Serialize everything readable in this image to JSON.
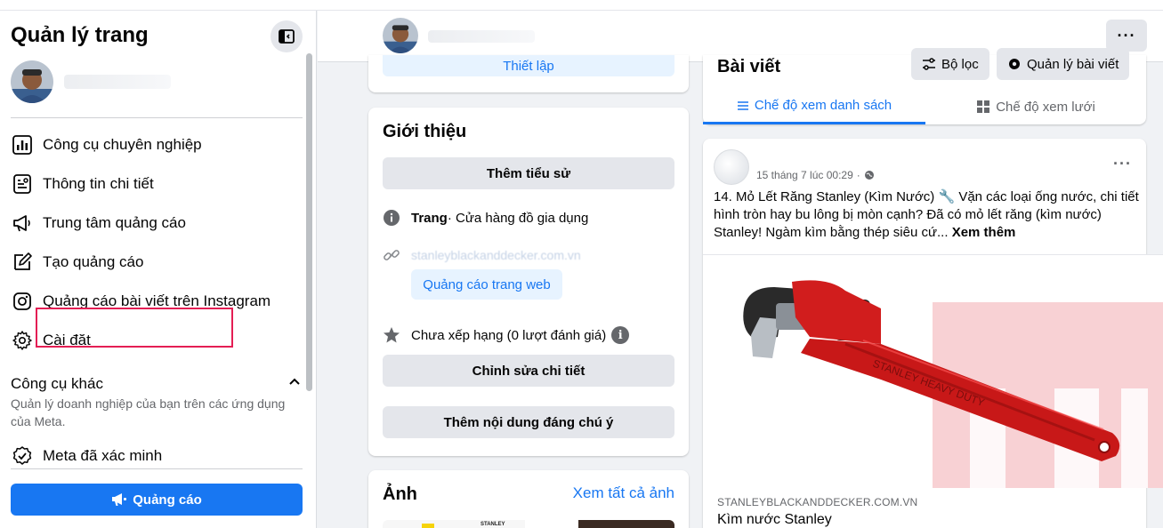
{
  "sidebar": {
    "title": "Quản lý trang",
    "items": [
      {
        "label": "Công cụ chuyên nghiệp",
        "icon": "bar-chart-icon"
      },
      {
        "label": "Thông tin chi tiết",
        "icon": "insights-icon"
      },
      {
        "label": "Trung tâm quảng cáo",
        "icon": "megaphone-icon"
      },
      {
        "label": "Tạo quảng cáo",
        "icon": "pencil-icon"
      },
      {
        "label": "Quảng cáo bài viết trên Instagram",
        "icon": "instagram-icon"
      },
      {
        "label": "Cài đặt",
        "icon": "gear-icon"
      }
    ],
    "other_tools": {
      "title": "Công cụ khác",
      "description": "Quản lý doanh nghiệp của bạn trên các ứng dụng của Meta."
    },
    "verified": {
      "label": "Meta đã xác minh",
      "icon": "verified-badge-icon"
    },
    "cta_label": "Quảng cáo"
  },
  "header": {
    "more_label": "···"
  },
  "setup_card": {
    "button_label": "Thiết lập"
  },
  "intro": {
    "title": "Giới thiệu",
    "add_bio_label": "Thêm tiểu sử",
    "category_label": "Trang",
    "category_value": " · Cửa hàng đồ gia dụng",
    "website_text": "stanleyblackanddecker.com.vn",
    "website_button": "Quảng cáo trang web",
    "rating_text": "Chưa xếp hạng (0 lượt đánh giá)",
    "edit_details_label": "Chỉnh sửa chi tiết",
    "featured_label": "Thêm nội dung đáng chú ý"
  },
  "photos": {
    "title": "Ảnh",
    "see_all_label": "Xem tất cả ảnh"
  },
  "posts": {
    "title": "Bài viết",
    "filter_label": "Bộ lọc",
    "manage_label": "Quản lý bài viết",
    "tabs": [
      {
        "label": "Chế độ xem danh sách",
        "active": true
      },
      {
        "label": "Chế độ xem lưới",
        "active": false
      }
    ]
  },
  "post": {
    "time": "15 tháng 7 lúc 00:29",
    "privacy_dot": "·",
    "more_label": "···",
    "body": "14. Mỏ Lết Răng Stanley (Kìm Nước) 🔧 Vặn các loại ống nước, chi tiết hình tròn hay bu lông bị mòn cạnh? Đã có mỏ lết răng (kìm nước) Stanley! Ngàm kìm bằng thép siêu cứ...",
    "see_more": "Xem thêm",
    "link_domain": "STANLEYBLACKANDDECKER.COM.VN",
    "link_title": "Kìm nước Stanley",
    "image_brand_text": "STANLEY HEAVY DUTY"
  },
  "colors": {
    "accent": "#1877f2",
    "highlight": "#e41e54",
    "watermark": "#f6b8bd"
  }
}
